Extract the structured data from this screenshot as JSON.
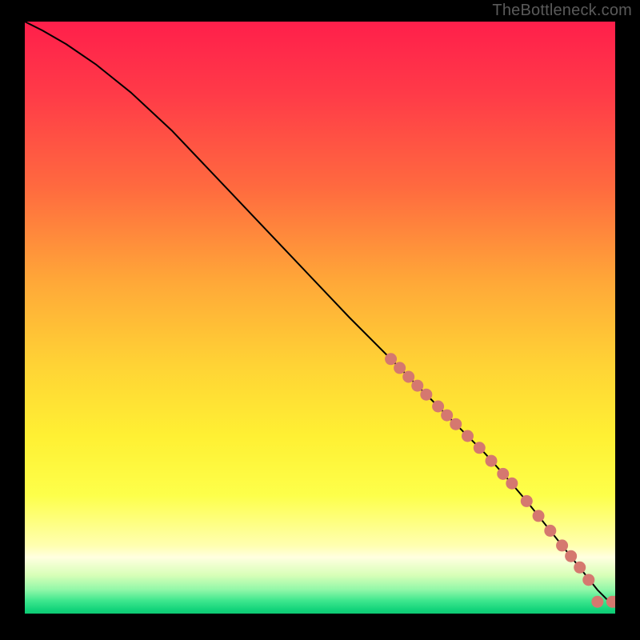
{
  "attribution": "TheBottleneck.com",
  "chart_data": {
    "type": "line",
    "title": "",
    "xlabel": "",
    "ylabel": "",
    "xlim": [
      0,
      100
    ],
    "ylim": [
      0,
      100
    ],
    "background_gradient": {
      "stops": [
        {
          "offset": 0.0,
          "color": "#ff1f4b"
        },
        {
          "offset": 0.12,
          "color": "#ff3a48"
        },
        {
          "offset": 0.28,
          "color": "#ff6a3f"
        },
        {
          "offset": 0.44,
          "color": "#ffa838"
        },
        {
          "offset": 0.58,
          "color": "#ffd335"
        },
        {
          "offset": 0.7,
          "color": "#fff033"
        },
        {
          "offset": 0.8,
          "color": "#fdff4a"
        },
        {
          "offset": 0.885,
          "color": "#ffffb0"
        },
        {
          "offset": 0.905,
          "color": "#ffffe0"
        },
        {
          "offset": 0.935,
          "color": "#d8ffb8"
        },
        {
          "offset": 0.96,
          "color": "#90f7a8"
        },
        {
          "offset": 0.978,
          "color": "#3fe78e"
        },
        {
          "offset": 0.993,
          "color": "#14d47b"
        },
        {
          "offset": 1.0,
          "color": "#0fca74"
        }
      ]
    },
    "series": [
      {
        "name": "curve",
        "x": [
          0.0,
          3.0,
          7.0,
          12.0,
          18.0,
          25.0,
          35.0,
          45.0,
          55.0,
          62.0,
          66.0,
          70.0,
          74.0,
          78.0,
          82.0,
          85.0,
          87.0,
          89.0,
          91.0,
          93.0,
          95.0,
          97.0,
          99.0,
          100.0
        ],
        "y": [
          100.0,
          98.5,
          96.2,
          92.8,
          88.0,
          81.5,
          71.0,
          60.5,
          50.0,
          43.0,
          39.0,
          35.0,
          31.0,
          27.0,
          22.5,
          19.0,
          16.5,
          14.0,
          11.5,
          9.0,
          6.5,
          4.0,
          2.0,
          2.0
        ]
      }
    ],
    "marker_points": {
      "name": "highlighted-segment",
      "color": "#d5786f",
      "points": [
        {
          "x": 62.0,
          "y": 43.0
        },
        {
          "x": 63.5,
          "y": 41.5
        },
        {
          "x": 65.0,
          "y": 40.0
        },
        {
          "x": 66.5,
          "y": 38.5
        },
        {
          "x": 68.0,
          "y": 37.0
        },
        {
          "x": 70.0,
          "y": 35.0
        },
        {
          "x": 71.5,
          "y": 33.5
        },
        {
          "x": 73.0,
          "y": 32.0
        },
        {
          "x": 75.0,
          "y": 30.0
        },
        {
          "x": 77.0,
          "y": 28.0
        },
        {
          "x": 79.0,
          "y": 25.8
        },
        {
          "x": 81.0,
          "y": 23.6
        },
        {
          "x": 82.5,
          "y": 22.0
        },
        {
          "x": 85.0,
          "y": 19.0
        },
        {
          "x": 87.0,
          "y": 16.5
        },
        {
          "x": 89.0,
          "y": 14.0
        },
        {
          "x": 91.0,
          "y": 11.5
        },
        {
          "x": 92.5,
          "y": 9.7
        },
        {
          "x": 94.0,
          "y": 7.8
        },
        {
          "x": 95.5,
          "y": 5.7
        },
        {
          "x": 97.0,
          "y": 2.0
        },
        {
          "x": 99.5,
          "y": 2.0
        },
        {
          "x": 100.0,
          "y": 2.0
        }
      ]
    }
  }
}
